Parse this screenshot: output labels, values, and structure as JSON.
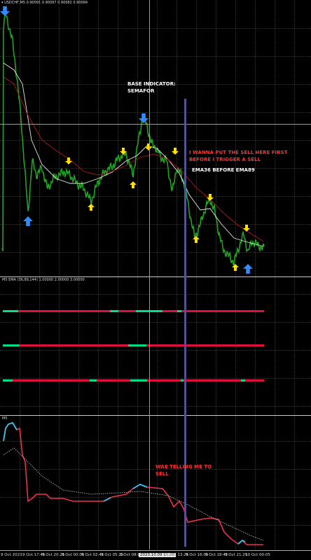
{
  "header": {
    "symbol_info": "▾ USDCHF,M5 0.90091 0.90097 0.90082 0.90084"
  },
  "indicator_panels": {
    "ema_label": "M5 EMA (36,89,144) 1.00000 2.00000 3.00000",
    "osc_label": "M5"
  },
  "annotations": {
    "base_indicator": "BASE INDICATOR:\nSEMAFOR",
    "sell_note": "I WANNA PUT THE SELL HERE FIRST\nBEFORE I TRIGGER A SELL",
    "ema_note": "EMA36 BEFORE EMA89",
    "wae_note": "WAE TELLING ME TO\nSELL"
  },
  "time_axis": {
    "labels": [
      "9 Oct 2023",
      "9 Oct 17:45",
      "9 Oct 20:25",
      "9 Oct 00:05",
      "9 Oct 02:45",
      "9 Oct 05:25",
      "9 Oct 08:05",
      "2023.10.09 11:20",
      "9 Oct 13:25",
      "9 Oct 16:05",
      "9 Oct 18:45",
      "9 Oct 21:25",
      "10 Oct 00:05"
    ]
  },
  "colors": {
    "background": "#000000",
    "price": "#1fa51f",
    "ema_fast": "#e8e8e8",
    "ema_slow": "#b01818",
    "arrow_up": "#ffe000",
    "semafor_blue": "#2f8cff",
    "trend_bull": "#00e08a",
    "trend_bear": "#e0103c",
    "wae_cyan": "#34c8f0",
    "wae_red": "#f0304c",
    "marker_line": "#4a4ad8"
  }
}
